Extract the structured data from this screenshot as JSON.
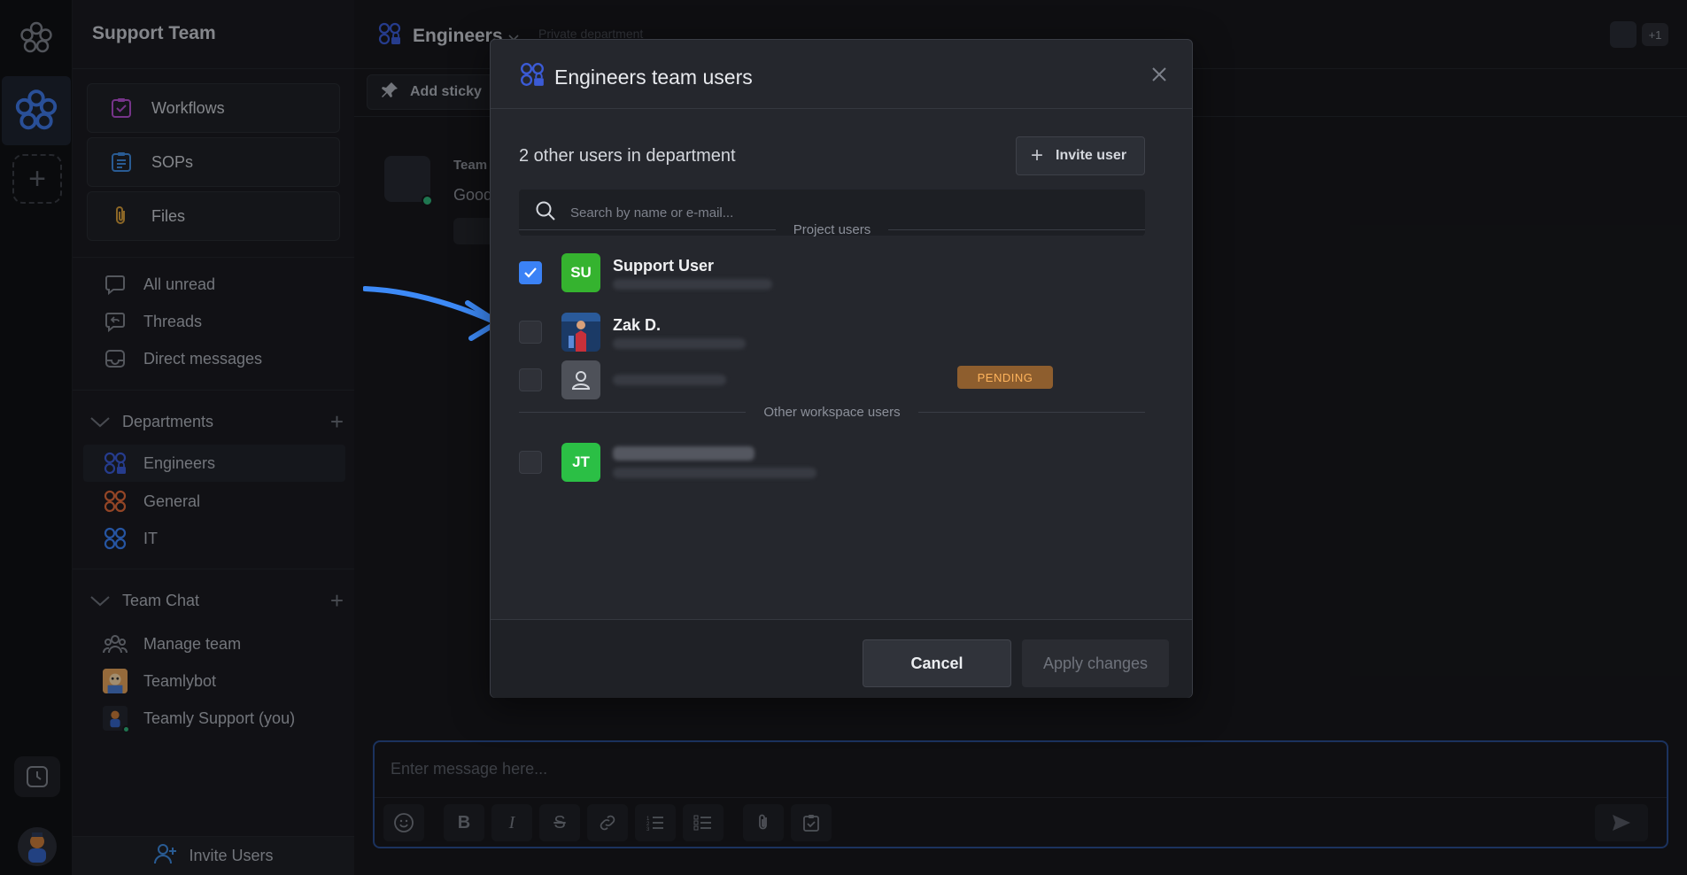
{
  "sidebar": {
    "workspace_name": "Support Team",
    "cards": [
      {
        "label": "Workflows",
        "icon": "workflow-check-icon"
      },
      {
        "label": "SOPs",
        "icon": "list-icon"
      },
      {
        "label": "Files",
        "icon": "paperclip-icon"
      }
    ],
    "nav": [
      {
        "label": "All unread",
        "icon": "chat-bubble-icon"
      },
      {
        "label": "Threads",
        "icon": "threads-icon"
      },
      {
        "label": "Direct messages",
        "icon": "inbox-icon"
      }
    ],
    "departments": {
      "title": "Departments",
      "items": [
        {
          "label": "Engineers",
          "color": "#3b5bd6"
        },
        {
          "label": "General",
          "color": "#e0693a"
        },
        {
          "label": "IT",
          "color": "#3b82f6"
        }
      ]
    },
    "team_chat": {
      "title": "Team Chat",
      "items": [
        {
          "label": "Manage team"
        },
        {
          "label": "Teamlybot"
        },
        {
          "label": "Teamly Support (you)"
        }
      ]
    },
    "footer_label": "Invite Users"
  },
  "main": {
    "title": "Engineers",
    "subtitle": "Private department",
    "top_extra": "+1",
    "sticky_label": "Add sticky",
    "message": {
      "author": "Team",
      "text": "Good"
    },
    "composer_placeholder": "Enter message here..."
  },
  "modal": {
    "title": "Engineers team users",
    "count_text": "2 other users in department",
    "invite_label": "Invite user",
    "search_placeholder": "Search by name or e-mail...",
    "project_users_label": "Project users",
    "other_users_label": "Other workspace users",
    "users": [
      {
        "initials": "SU",
        "name": "Support User",
        "checked": true
      },
      {
        "initials": "",
        "name": "Zak D.",
        "checked": false
      },
      {
        "initials": "",
        "name": "",
        "checked": false,
        "status": "PENDING"
      }
    ],
    "other_users": [
      {
        "initials": "JT",
        "checked": false
      }
    ],
    "cancel_label": "Cancel",
    "apply_label": "Apply changes"
  },
  "colors": {
    "accent": "#3b82f6",
    "pending_bg": "#8e5e2e",
    "pending_text": "#ffb45c",
    "avatar_green": "#35b32f"
  }
}
